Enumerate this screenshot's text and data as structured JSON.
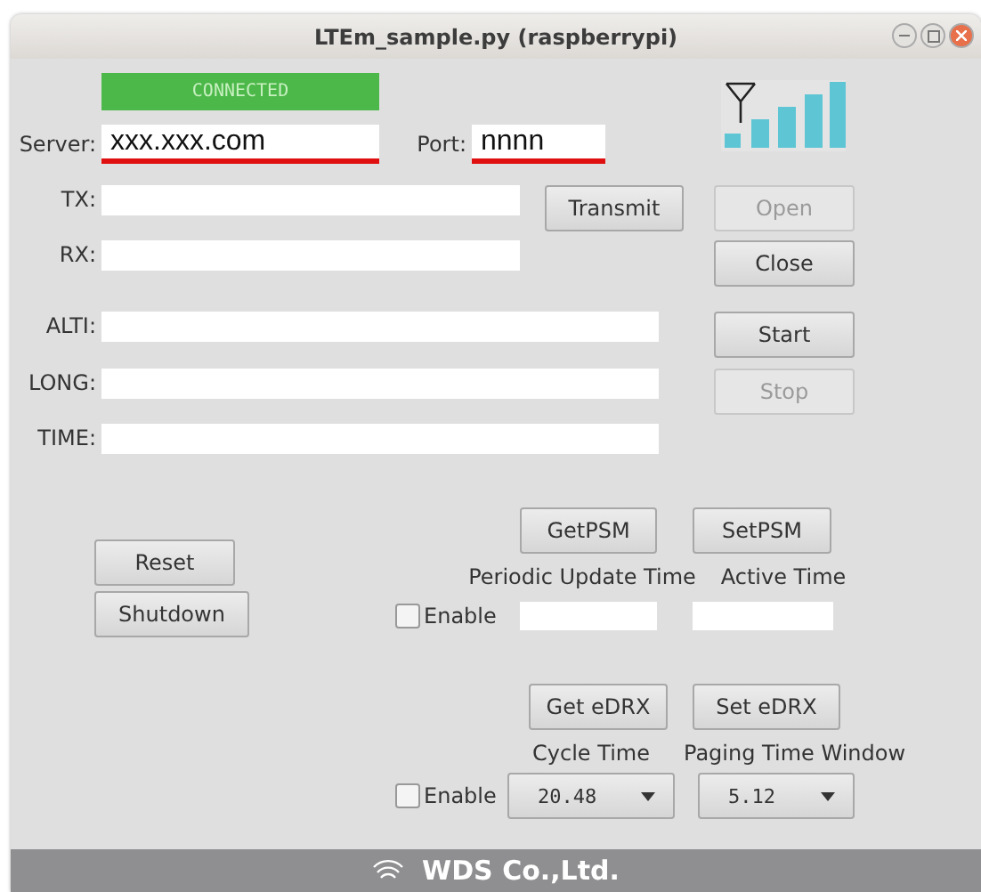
{
  "window": {
    "title": "LTEm_sample.py (raspberrypi)"
  },
  "status": {
    "label": "CONNECTED",
    "connected": true
  },
  "server": {
    "label": "Server:",
    "value": "xxx.xxx.com"
  },
  "port": {
    "label": "Port:",
    "value": "nnnn"
  },
  "serial": {
    "tx_label": "TX:",
    "rx_label": "RX:",
    "transmit": {
      "label": "Transmit",
      "disabled": false
    }
  },
  "port_buttons": [
    {
      "label": "Open",
      "disabled": true
    },
    {
      "label": "Close",
      "disabled": false
    }
  ],
  "gps": {
    "fields": [
      {
        "label": "ALTI:"
      },
      {
        "label": "LONG:"
      },
      {
        "label": "TIME:"
      }
    ],
    "buttons": [
      {
        "label": "Start",
        "disabled": false
      },
      {
        "label": "Stop",
        "disabled": true
      }
    ]
  },
  "system_buttons": [
    {
      "label": "Reset"
    },
    {
      "label": "Shutdown"
    }
  ],
  "psm": {
    "buttons": [
      {
        "label": "GetPSM"
      },
      {
        "label": "SetPSM"
      }
    ],
    "enable": {
      "label": "Enable",
      "checked": false
    },
    "fields": [
      {
        "label": "Periodic Update Time"
      },
      {
        "label": "Active Time"
      }
    ]
  },
  "edrx": {
    "buttons": [
      {
        "label": "Get eDRX"
      },
      {
        "label": "Set eDRX"
      }
    ],
    "enable": {
      "label": "Enable",
      "checked": false
    },
    "selects": [
      {
        "label": "Cycle Time",
        "value": "20.48"
      },
      {
        "label": "Paging Time Window",
        "value": "5.12"
      }
    ]
  },
  "footer": {
    "company": "WDS Co.,Ltd."
  }
}
